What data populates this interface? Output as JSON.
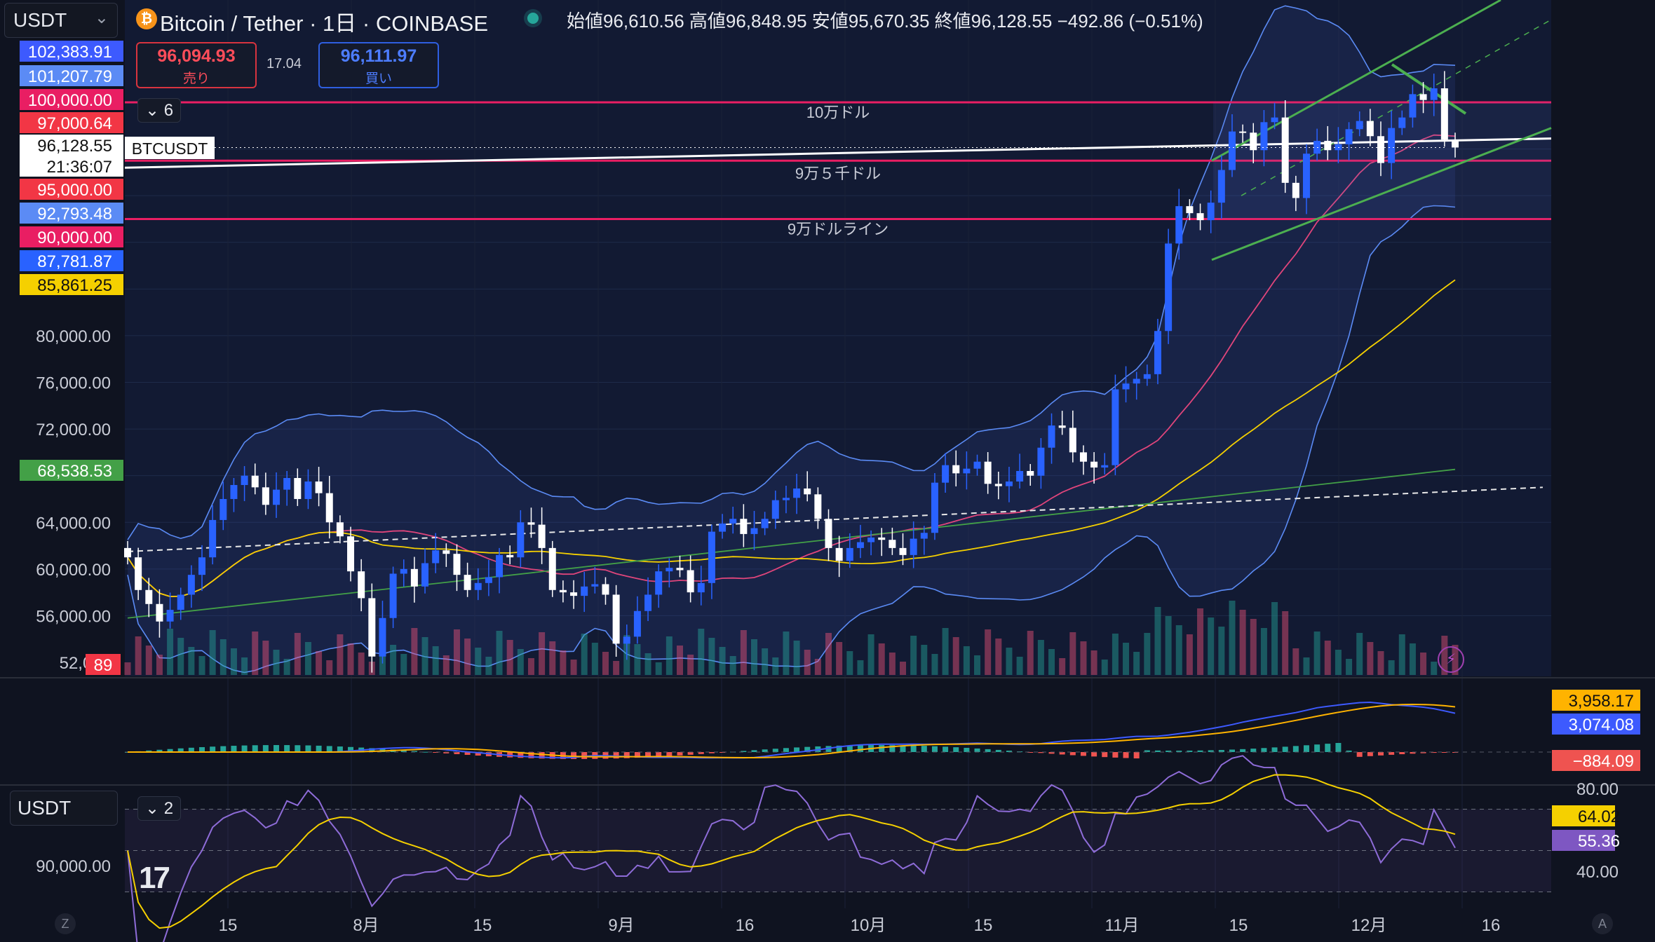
{
  "header": {
    "symbol_selector": "USDT",
    "symbol_selector_arrow": "⌄",
    "coin_icon": "₿",
    "title": "Bitcoin / Tether · 1日 · COINBASE",
    "ohlc": "始値96,610.56  高値96,848.95  安値95,670.35  終値96,128.55  −492.86 (−0.51%)"
  },
  "trade": {
    "sell_price": "96,094.93",
    "sell_label": "売り",
    "spread": "17.04",
    "buy_price": "96,111.97",
    "buy_label": "買い"
  },
  "overlay_toggle": "⌄ 6",
  "rsi_toggle": "⌄ 2",
  "rsi_selector": "USDT",
  "tv_logo": "17",
  "colors": {
    "background": "#0f1320",
    "up_candle": "#2962ff",
    "down_candle": "#ffffff",
    "resistance_line": "#e91e63",
    "channel": "#4caf50",
    "bollinger": "#5b8bf5",
    "ma_short": "#e0457b",
    "ma_mid": "#f5d000",
    "ma_long": "#43a047",
    "macd_line": "#3d5afe",
    "signal_line": "#ffb300",
    "rsi_line": "#8e6cd8",
    "rsi_ma": "#f5d000"
  },
  "chart_data": [
    {
      "type": "candlestick",
      "symbol_tag": "BTCUSDT",
      "ylim": [
        50500,
        110000
      ],
      "price_axis_ticks": [
        "80,000.00",
        "76,000.00",
        "72,000.00",
        "64,000.00",
        "60,000.00",
        "56,000.00",
        "52,000"
      ],
      "price_axis_tick_values": [
        80000,
        76000,
        72000,
        64000,
        60000,
        56000,
        52000
      ],
      "x_axis_ticks": [
        "15",
        "8月",
        "15",
        "9月",
        "16",
        "10月",
        "15",
        "11月",
        "15",
        "12月",
        "16"
      ],
      "price_badges": [
        {
          "text": "102,383.91",
          "color": "#3d5afe",
          "value": 102383.91
        },
        {
          "text": "101,207.79",
          "color": "#5b8bf5",
          "value": 101207.79
        },
        {
          "text": "100,000.00",
          "color": "#e91e63",
          "value": 100000
        },
        {
          "text": "97,000.64",
          "color": "#f23645",
          "value": 97000.64
        },
        {
          "text": "96,128.55",
          "color": "#ffffff",
          "value": 96128.55
        },
        {
          "text": "21:36:07",
          "color": "#ffffff",
          "value": 96128.55
        },
        {
          "text": "95,000.00",
          "color": "#f23645",
          "value": 95000
        },
        {
          "text": "92,793.48",
          "color": "#5b8bf5",
          "value": 92793.48
        },
        {
          "text": "90,000.00",
          "color": "#e91e63",
          "value": 90000
        },
        {
          "text": "87,781.87",
          "color": "#2962ff",
          "value": 87781.87
        },
        {
          "text": "85,861.25",
          "color": "#f5d000",
          "value": 85861.25
        },
        {
          "text": "68,538.53",
          "color": "#43a047",
          "value": 68538.53
        }
      ],
      "volume_badge": "89",
      "horizontal_lines": [
        {
          "label": "10万ドル",
          "value": 100000,
          "color": "#e91e63"
        },
        {
          "label": "9万５千ドル",
          "value": 95000,
          "color": "#e91e63"
        },
        {
          "label": "9万ドルライン",
          "value": 90000,
          "color": "#e91e63"
        }
      ],
      "candles_close": [
        61000,
        58200,
        57000,
        55500,
        56500,
        57800,
        59500,
        61000,
        64200,
        66000,
        67200,
        68000,
        67000,
        65500,
        66800,
        67800,
        66000,
        67500,
        66500,
        64000,
        62800,
        59800,
        57500,
        52500,
        55800,
        59600,
        60000,
        58500,
        60500,
        61600,
        61300,
        59500,
        58200,
        58800,
        59300,
        61200,
        61000,
        64000,
        63800,
        61800,
        58200,
        58000,
        57700,
        58500,
        58700,
        57800,
        53600,
        54200,
        56400,
        57800,
        59800,
        60100,
        59900,
        58000,
        58800,
        63200,
        63900,
        64300,
        63000,
        63500,
        64300,
        65900,
        66100,
        66900,
        66400,
        64300,
        61800,
        60700,
        61800,
        62300,
        62700,
        62500,
        61800,
        61200,
        62600,
        63100,
        67400,
        68900,
        68200,
        68600,
        69200,
        67300,
        67100,
        67500,
        68400,
        68000,
        70400,
        72300,
        72100,
        70000,
        69200,
        68700,
        68900,
        75400,
        75900,
        76300,
        76700,
        80400,
        87900,
        91100,
        90500,
        89900,
        91400,
        94200,
        97500,
        97400,
        95900,
        98300,
        98700,
        93100,
        91800,
        95600,
        96700,
        95900,
        96400,
        97700,
        98400,
        97100,
        94800,
        97800,
        98700,
        100700,
        100200,
        101200,
        96800,
        96128
      ]
    },
    {
      "type": "macd",
      "values": {
        "signal": "3,958.17",
        "macd": "3,074.08",
        "histogram": "−884.09"
      }
    },
    {
      "type": "rsi",
      "axis_ticks": [
        "80.00",
        "40.00"
      ],
      "axis_tick_values": [
        80,
        40
      ],
      "left_label": "90,000.00",
      "values": {
        "rsi_ma": "64.02",
        "rsi": "55.36"
      }
    }
  ],
  "corner_buttons": {
    "left": "Z",
    "right": "A"
  }
}
